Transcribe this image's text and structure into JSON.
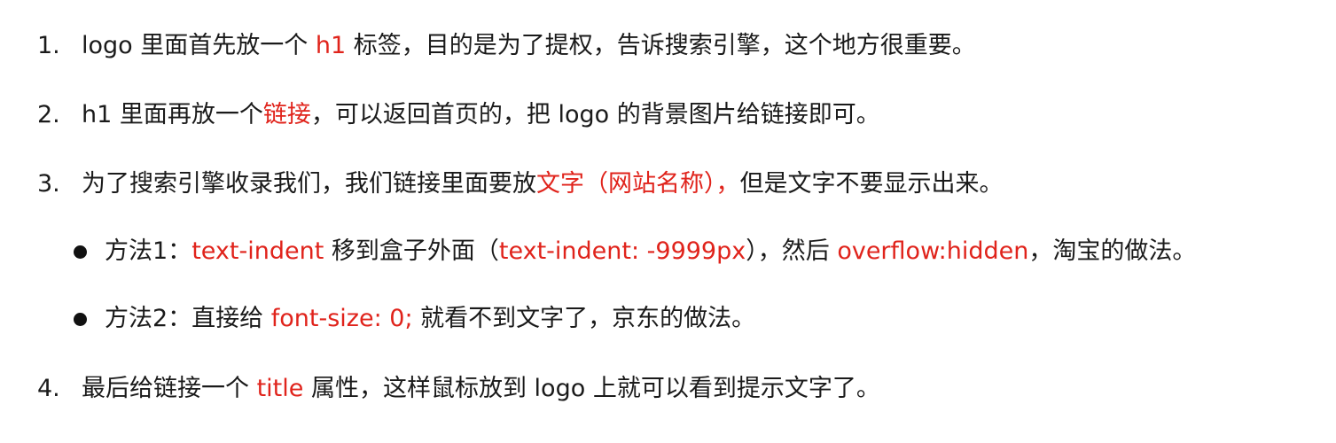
{
  "colors": {
    "text": "#1a1a1a",
    "highlight": "#e0231b",
    "background": "#ffffff"
  },
  "list": [
    {
      "marker": "1.",
      "parts": [
        "logo 里面首先放一个 ",
        "h1",
        " 标签，目的是为了提权，告诉搜索引擎，这个地方很重要。"
      ]
    },
    {
      "marker": "2.",
      "parts": [
        "h1 里面再放一个",
        "链接",
        "，可以返回首页的，把 logo 的背景图片给链接即可。"
      ]
    },
    {
      "marker": "3.",
      "parts": [
        "为了搜索引擎收录我们，我们链接里面要放",
        "文字（网站名称），",
        "但是文字不要显示出来。"
      ],
      "bullets": [
        {
          "parts": [
            "方法1：",
            "text-indent",
            " 移到盒子外面（",
            "text-indent: -9999px",
            "），然后 ",
            "overflow:hidden",
            "，淘宝的做法。"
          ]
        },
        {
          "parts": [
            "方法2：直接给 ",
            "font-size: 0;",
            " 就看不到文字了，京东的做法。"
          ]
        }
      ]
    },
    {
      "marker": "4.",
      "parts": [
        "最后给链接一个 ",
        "title",
        " 属性，这样鼠标放到 logo 上就可以看到提示文字了。"
      ]
    }
  ]
}
